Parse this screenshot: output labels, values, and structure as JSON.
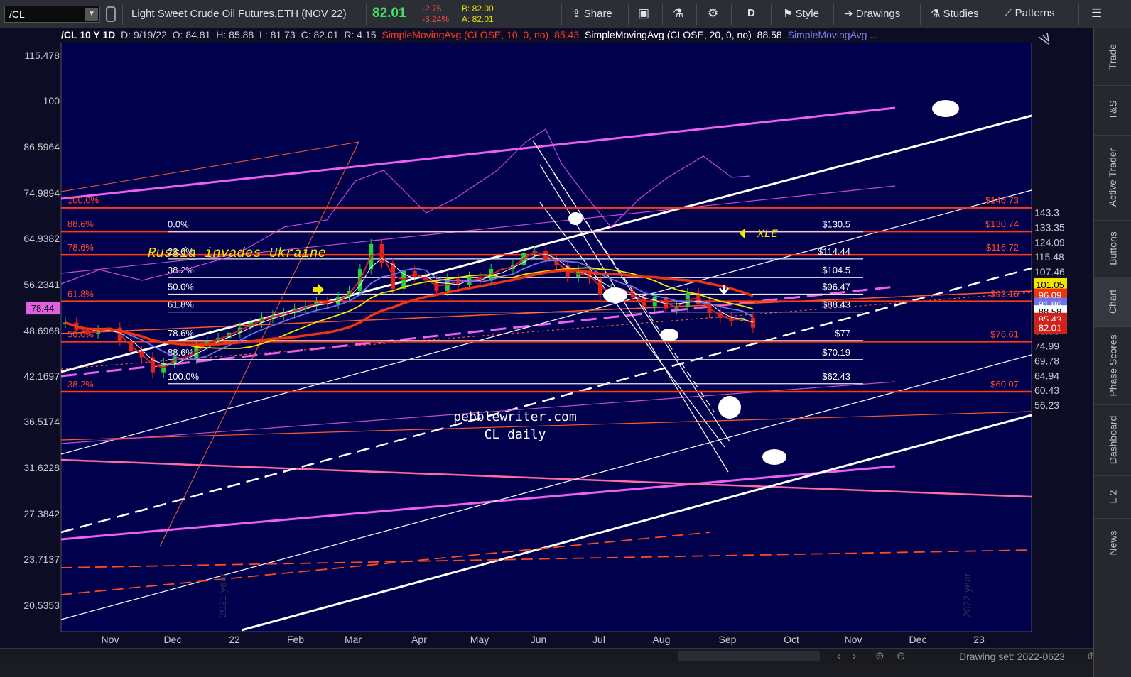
{
  "toolbar": {
    "symbol": "/CL",
    "description": "Light Sweet Crude Oil Futures,ETH (NOV 22)",
    "last": "82.01",
    "change": "-2.75",
    "change_pct": "-3.24%",
    "bid": "B: 82.00",
    "ask": "A: 82.01",
    "share": "Share",
    "timeframe": "D",
    "style": "Style",
    "drawings": "Drawings",
    "studies": "Studies",
    "patterns": "Patterns"
  },
  "sidebar": [
    "Trade",
    "T&S",
    "Active Trader",
    "Buttons",
    "Chart",
    "Phase Scores",
    "Dashboard",
    "L 2",
    "News"
  ],
  "header": {
    "symbol_period": "/CL 10 Y 1D",
    "date": "D: 9/19/22",
    "open": "O: 84.81",
    "high": "H: 85.88",
    "low": "L: 81.73",
    "close": "C: 82.01",
    "range": "R: 4.15",
    "sma10": "SimpleMovingAvg (CLOSE, 10, 0, no)",
    "sma10_val": "85.43",
    "sma20": "SimpleMovingAvg (CLOSE, 20, 0, no)",
    "sma20_val": "88.58",
    "sma3": "SimpleMovingAvg ..."
  },
  "footer": {
    "drawing_set": "Drawing set: 2022-0623"
  },
  "chart_data": {
    "type": "line",
    "title": "",
    "xlabel": "",
    "ylabel": "",
    "ylim": [
      53,
      153
    ],
    "log_scale": true,
    "grid": false,
    "x_ticks": [
      "Nov",
      "Dec",
      "22",
      "Feb",
      "Mar",
      "Apr",
      "May",
      "Jun",
      "Jul",
      "Aug",
      "Sep",
      "Oct",
      "Nov",
      "Dec",
      "23"
    ],
    "y_ticks_right": [
      "143.3",
      "133.35",
      "124.09",
      "115.48",
      "107.46",
      "100",
      "93.06",
      "86.6",
      "80.58",
      "74.99",
      "69.78",
      "64.94",
      "60.43",
      "56.23"
    ],
    "y_ticks_left": [
      "115.478",
      "100",
      "86.5964",
      "74.9894",
      "64.9382",
      "56.2341",
      "48.6968",
      "42.1697",
      "36.5174",
      "31.6228",
      "27.3842",
      "23.7137",
      "20.5353"
    ],
    "price_tags": [
      {
        "label": "101.05",
        "value": 101.05,
        "color": "#f2e600",
        "text_color": "#000000"
      },
      {
        "label": "96.09",
        "value": 96.09,
        "color": "#ee3311",
        "text_color": "#ffffff"
      },
      {
        "label": "91.86",
        "value": 91.86,
        "color": "#6f71e8",
        "text_color": "#ffffff"
      },
      {
        "label": "88.58",
        "value": 88.58,
        "color": "#ffffff",
        "text_color": "#000000"
      },
      {
        "label": "85.43",
        "value": 85.43,
        "color": "#d0221b",
        "text_color": "#ffffff"
      },
      {
        "label": "82.01",
        "value": 82.01,
        "color": "#d0221b",
        "text_color": "#ffffff"
      }
    ],
    "xle_tag": "78.44",
    "fib_right_labels": [
      {
        "label": "$146.73",
        "value": 146.73
      },
      {
        "label": "$130.74",
        "value": 130.74
      },
      {
        "label": "$116.72",
        "value": 116.72
      },
      {
        "label": "$93.16",
        "value": 93.16
      },
      {
        "label": "$76.61",
        "value": 76.61
      },
      {
        "label": "$60.07",
        "value": 60.07
      }
    ],
    "fib_left_labels": [
      "100.0%",
      "88.6%",
      "78.6%",
      "61.8%",
      "50.0%",
      "38.2%"
    ],
    "retracement_levels": [
      {
        "pct": "0.0%",
        "price": "$130.5",
        "value": 130.5
      },
      {
        "pct": "23.6%",
        "price": "$114.44",
        "value": 114.44
      },
      {
        "pct": "38.2%",
        "price": "$104.5",
        "value": 104.5
      },
      {
        "pct": "50.0%",
        "price": "$96.47",
        "value": 96.47
      },
      {
        "pct": "61.8%",
        "price": "$88.43",
        "value": 88.43
      },
      {
        "pct": "78.6%",
        "price": "$77",
        "value": 77
      },
      {
        "pct": "88.6%",
        "price": "$70.19",
        "value": 70.19
      },
      {
        "pct": "100.0%",
        "price": "$62.43",
        "value": 62.43
      }
    ],
    "annotations": [
      "Russia invades Ukraine",
      "XLE",
      "pebblewriter.com",
      "CL daily",
      "2021 year",
      "2022 year"
    ],
    "close_series": [
      84,
      81,
      79.5,
      81,
      82,
      77,
      73,
      71,
      66,
      69,
      71,
      70.5,
      75,
      77,
      78,
      80,
      82,
      84,
      86,
      87,
      88,
      90,
      91,
      93,
      92,
      95,
      98,
      109,
      123,
      112,
      99,
      108,
      105,
      103,
      98,
      104,
      101,
      105,
      103,
      109,
      109,
      111,
      118,
      119,
      114,
      111,
      105,
      108,
      104,
      96,
      99,
      98,
      95,
      91,
      95,
      90,
      91,
      97,
      92,
      88,
      86,
      84.5,
      86,
      82
    ],
    "series_names": [
      {
        "name": "SimpleMovingAvg (CLOSE, 10, 0, no)",
        "last": 85.43,
        "color": "#d0221b"
      },
      {
        "name": "SimpleMovingAvg (CLOSE, 20, 0, no)",
        "last": 88.58,
        "color": "#ffffff"
      },
      {
        "name": "SimpleMovingAvg ...",
        "last": 91.86,
        "color": "#6f71e8"
      }
    ]
  }
}
